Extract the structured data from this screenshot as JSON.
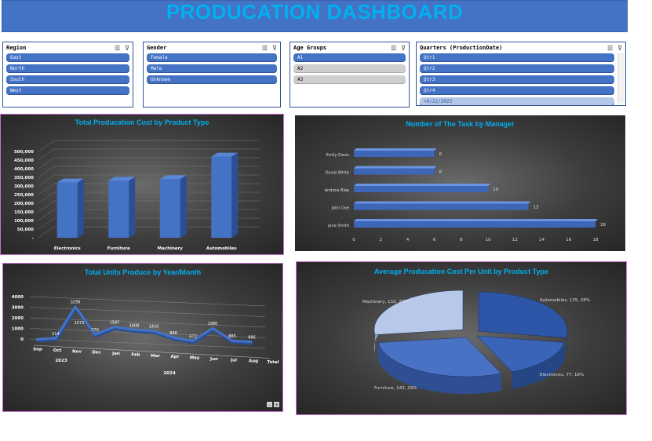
{
  "dashboard": {
    "title": "PRODUCATION DASHBOARD"
  },
  "slicers": {
    "region": {
      "title": "Region",
      "items": [
        "East",
        "North",
        "South",
        "West"
      ]
    },
    "gender": {
      "title": "Gender",
      "items": [
        "Female",
        "Male",
        "Unknown"
      ]
    },
    "age": {
      "title": "Age Groups",
      "items": [
        "A1",
        "A2",
        "A3"
      ]
    },
    "quarters": {
      "title": "Quarters (ProductionDate)",
      "items": [
        "Qtr1",
        "Qtr2",
        "Qtr3",
        "Qtr4",
        "<9/22/2023"
      ]
    }
  },
  "colors": {
    "accent": "#4472c4",
    "title": "#00b0f0",
    "panelDark": "#333333"
  },
  "chart_data": [
    {
      "type": "bar",
      "title": "Total Producation Cost by Product Type",
      "categories": [
        "Electronics",
        "Furniture",
        "Machinery",
        "Automobiles"
      ],
      "values": [
        320000,
        330000,
        340000,
        470000
      ],
      "ylim": [
        0,
        500000
      ],
      "yticks": [
        "500,000",
        "450,000",
        "400,000",
        "350,000",
        "300,000",
        "250,000",
        "200,000",
        "150,000",
        "100,000",
        "50,000",
        "-"
      ]
    },
    {
      "type": "bar",
      "orientation": "horizontal",
      "title": "Number of The Task by Manager",
      "categories": [
        "Emily Davis",
        "David White",
        "Andrew Blae",
        "John Doe",
        "Jane Smith"
      ],
      "values": [
        6,
        6,
        10,
        13,
        18
      ],
      "xlim": [
        0,
        18
      ],
      "xticks": [
        "0",
        "2",
        "4",
        "6",
        "8",
        "10",
        "12",
        "14",
        "16",
        "18"
      ]
    },
    {
      "type": "line",
      "title": "Total Units Produce by Year/Month",
      "categories": [
        "Sep",
        "Oct",
        "Nov",
        "Dec",
        "Jan",
        "Feb",
        "Mar",
        "Apr",
        "May",
        "Jun",
        "Jul",
        "Aug",
        "Total"
      ],
      "values": [
        0,
        214,
        3298,
        770,
        1587,
        1408,
        1410,
        888,
        672,
        1980,
        885,
        886
      ],
      "labels": [
        "",
        "214",
        "3298",
        "770",
        "1587",
        "1408",
        "1410",
        "888",
        "672",
        "1980",
        "885",
        "886"
      ],
      "extra_label": "1573",
      "years": [
        "2023",
        "2024"
      ],
      "ylim": [
        0,
        4000
      ],
      "yticks": [
        "4000",
        "3000",
        "2000",
        "1000",
        "0"
      ]
    },
    {
      "type": "pie",
      "title": "Average Producation Cost Per Unit by Product Type",
      "slices": [
        {
          "name": "Automobiles",
          "value": 135,
          "label": "Automobiles, 135, 28%"
        },
        {
          "name": "Electronics",
          "value": 77,
          "label": "Electronics, 77, 16%"
        },
        {
          "name": "Furniture",
          "value": 143,
          "label": "Furniture, 143, 29%"
        },
        {
          "name": "Machinery",
          "value": 132,
          "label": "Machinery, 132, 27%"
        }
      ]
    }
  ]
}
